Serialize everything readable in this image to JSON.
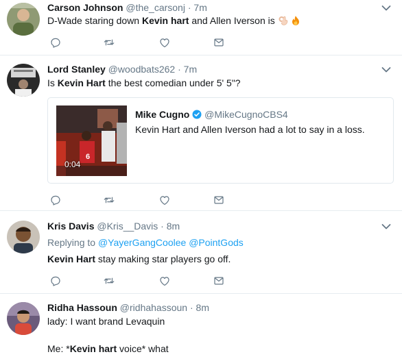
{
  "tweets": [
    {
      "name": "Carson Johnson",
      "handle": "@the_carsonj",
      "sep": "·",
      "time": "7m",
      "text_pre": "D-Wade staring down ",
      "text_bold": "Kevin hart",
      "text_post": " and Allen Iverson is "
    },
    {
      "name": "Lord Stanley",
      "handle": "@woodbats262",
      "sep": "·",
      "time": "7m",
      "text_pre": "Is ",
      "text_bold": "Kevin Hart",
      "text_post": " the best comedian under 5' 5\"?",
      "quote": {
        "name": "Mike Cugno",
        "handle": "@MikeCugnoCBS4",
        "text": "Kevin Hart and Allen Iverson had a lot to say in a loss.",
        "duration": "0:04",
        "verified_color": "#1da1f2"
      }
    },
    {
      "name": "Kris Davis",
      "handle": "@Kris__Davis",
      "sep": "·",
      "time": "8m",
      "reply_prefix": "Replying to ",
      "reply_user1": "@YayerGangCoolee",
      "reply_user2": "@PointGods",
      "text_bold": "Kevin Hart",
      "text_post": " stay making star players go off."
    },
    {
      "name": "Ridha Hassoun",
      "handle": "@ridhahassoun",
      "sep": "·",
      "time": "8m",
      "line1": "lady: I want brand Levaquin",
      "line2_pre": "Me: *",
      "line2_bold": "Kevin hart",
      "line2_post": " voice* what"
    }
  ],
  "icons": [
    "reply-icon",
    "retweet-icon",
    "like-icon",
    "message-icon",
    "chevron-down-icon",
    "verified-icon",
    "ok-hand-emoji-icon",
    "fire-emoji-icon"
  ],
  "colors": {
    "name": "#14171a",
    "meta": "#657786",
    "link": "#1da1f2",
    "icon": "#657786",
    "divider": "#e6ecf0"
  }
}
